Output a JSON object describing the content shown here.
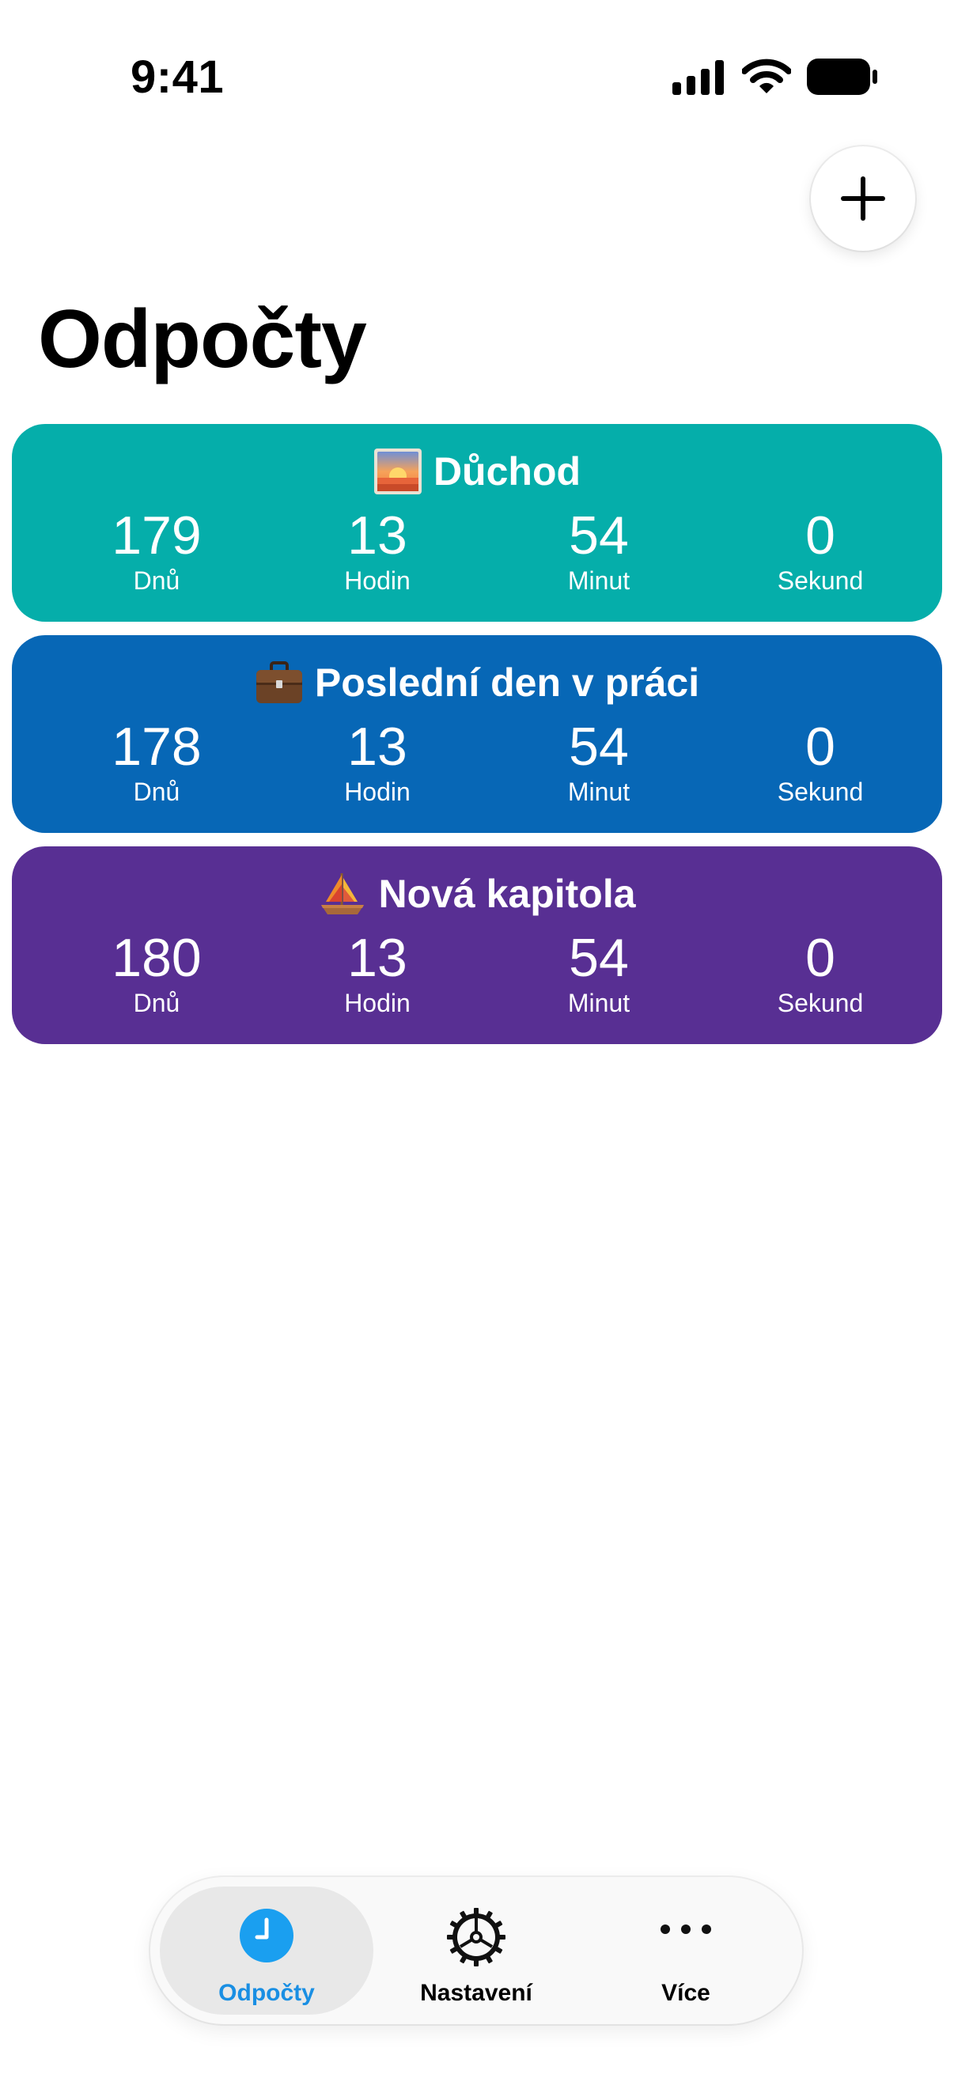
{
  "status_bar": {
    "time": "9:41"
  },
  "header": {
    "title": "Odpočty",
    "add_icon": "plus-icon"
  },
  "countdowns": [
    {
      "title": "Důchod",
      "emoji": "sunrise",
      "color": "#05AEAA",
      "units": [
        {
          "value": "179",
          "label": "Dnů"
        },
        {
          "value": "13",
          "label": "Hodin"
        },
        {
          "value": "54",
          "label": "Minut"
        },
        {
          "value": "0",
          "label": "Sekund"
        }
      ]
    },
    {
      "title": "Poslední den v práci",
      "emoji": "briefcase",
      "color": "#0767B6",
      "units": [
        {
          "value": "178",
          "label": "Dnů"
        },
        {
          "value": "13",
          "label": "Hodin"
        },
        {
          "value": "54",
          "label": "Minut"
        },
        {
          "value": "0",
          "label": "Sekund"
        }
      ]
    },
    {
      "title": "Nová kapitola",
      "emoji": "sailboat",
      "color": "#582F93",
      "units": [
        {
          "value": "180",
          "label": "Dnů"
        },
        {
          "value": "13",
          "label": "Hodin"
        },
        {
          "value": "54",
          "label": "Minut"
        },
        {
          "value": "0",
          "label": "Sekund"
        }
      ]
    }
  ],
  "tab_bar": {
    "tabs": [
      {
        "label": "Odpočty",
        "icon": "clock-icon",
        "active": true
      },
      {
        "label": "Nastavení",
        "icon": "gear-icon",
        "active": false
      },
      {
        "label": "Více",
        "icon": "ellipsis-icon",
        "active": false
      }
    ],
    "accent_color": "#1A8FE3"
  }
}
